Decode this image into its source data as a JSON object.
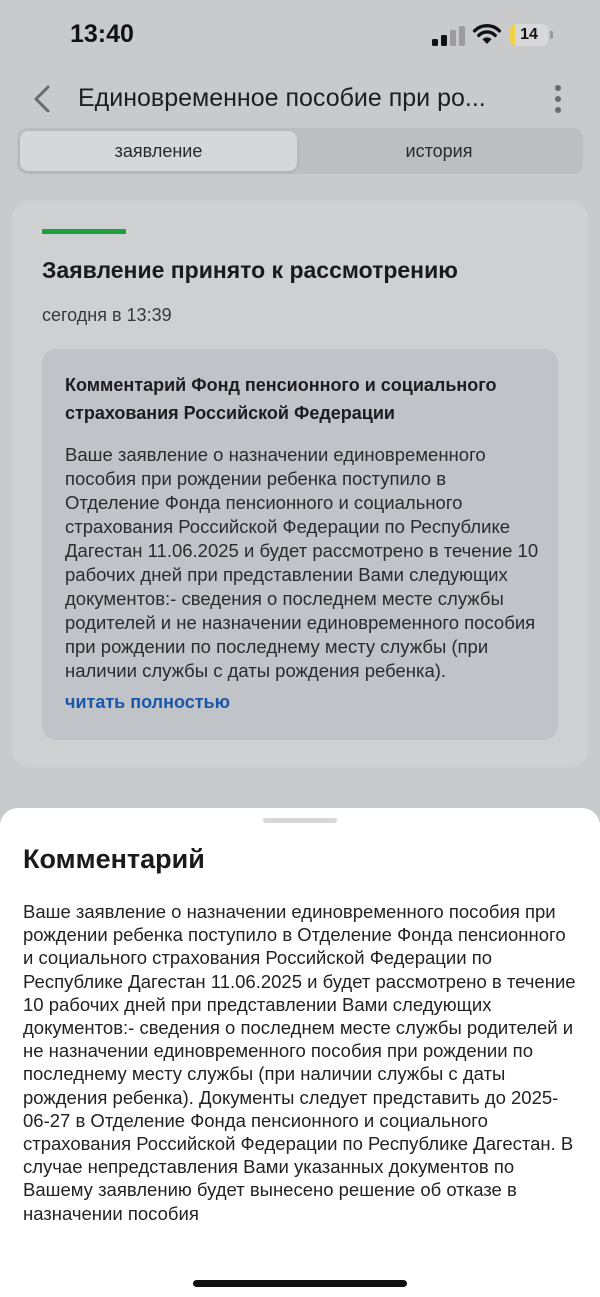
{
  "status_bar": {
    "time": "13:40",
    "battery": "14",
    "battery_level": 0.14
  },
  "header": {
    "title": "Единовременное пособие при ро..."
  },
  "tabs": [
    {
      "label": "заявление",
      "active": true
    },
    {
      "label": "история",
      "active": false
    }
  ],
  "card": {
    "status_title": "Заявление принято к рассмотрению",
    "date": "сегодня в 13:39",
    "comment_heading": "Комментарий Фонд пенсионного и социального страхования Российской Федерации",
    "comment_preview": "Ваше заявление о назначении единовременного пособия при рождении ребенка поступило в Отделение Фонда пенсионного и социального страхования Российской Федерации по Республике Дагестан 11.06.2025 и будет рассмотрено в течение 10 рабочих дней при представлении Вами следующих документов:- сведения о последнем месте службы родителей и не назначении единовременного пособия при рождении по последнему месту службы (при наличии службы с даты рождения ребенка).",
    "read_more": "читать полностью"
  },
  "sheet": {
    "title": "Комментарий",
    "text": "Ваше заявление о назначении единовременного пособия при рождении ребенка поступило в Отделение Фонда пенсионного и социального страхования Российской Федерации по Республике Дагестан 11.06.2025 и будет рассмотрено в течение 10 рабочих дней при представлении Вами следующих документов:- сведения о последнем месте службы родителей и не назначении единовременного пособия при рождении по последнему месту службы (при наличии службы с даты рождения ребенка). Документы следует представить до 2025-06-27 в Отделение Фонда пенсионного и социального страхования Российской Федерации по Республике Дагестан. В случае непредставления Вами указанных документов по Вашему заявлению будет вынесено решение об отказе в назначении пособия"
  },
  "colors": {
    "accent": "#1b57a8",
    "status_green": "#1e9e3c"
  },
  "icons": {
    "back": "chevron-left-icon",
    "more": "more-vertical-icon",
    "signal": "cellular-signal-icon",
    "wifi": "wifi-icon",
    "battery": "battery-icon"
  }
}
